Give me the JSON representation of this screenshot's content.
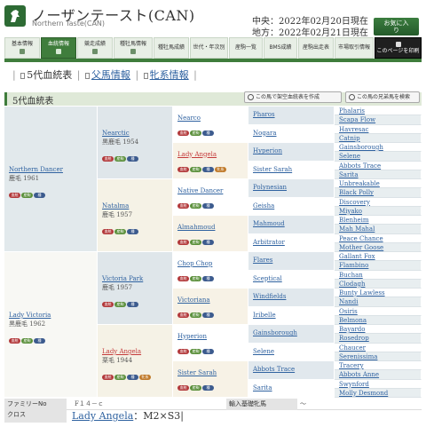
{
  "header": {
    "horse_name": "ノーザンテースト(CAN)",
    "horse_name_en": "Northern Taste(CAN)",
    "central_date": "中央：2022年02月20日現在",
    "local_date": "地方：2022年02月21日現在",
    "favorite_label_1": "お気に入",
    "favorite_label_2": "り",
    "logo_icon": "horse-icon"
  },
  "tabs": [
    {
      "label": "基本情報"
    },
    {
      "label": "血統情報"
    },
    {
      "label": "競走成績"
    },
    {
      "label": "種牡馬情報"
    },
    {
      "label": "種牡馬成績"
    },
    {
      "label": "世代・年次別"
    },
    {
      "label": "産駒一覧"
    },
    {
      "label": "BMS成績"
    },
    {
      "label": "産駒出走表"
    },
    {
      "label": "市場取引情報"
    },
    {
      "label": "このページを印刷"
    }
  ],
  "subnav": {
    "five_gen": "5代血統表",
    "sire_line": "父馬情報",
    "dam_line": "牝系情報"
  },
  "section": {
    "title": "5代血統表",
    "make_pedigree_btn": "この馬で架空血統表を作成",
    "siblings_btn": "この馬の兄弟馬を検索"
  },
  "badges": {
    "b1": "血統",
    "b2": "産駒",
    "b3": "種",
    "b4": "牝系"
  },
  "pedigree": {
    "g1": [
      {
        "name": "Northern Dancer",
        "meta": "鹿毛 1961",
        "red": false
      },
      {
        "name": "Lady Victoria",
        "meta": "黒鹿毛 1962",
        "red": false
      }
    ],
    "g2": [
      {
        "name": "Nearctic",
        "meta": "黒鹿毛 1954",
        "red": false
      },
      {
        "name": "Natalma",
        "meta": "鹿毛 1957",
        "red": false
      },
      {
        "name": "Victoria Park",
        "meta": "鹿毛 1957",
        "red": false
      },
      {
        "name": "Lady Angela",
        "meta": "栗毛 1944",
        "red": true
      }
    ],
    "g3": [
      {
        "name": "Nearco",
        "red": false
      },
      {
        "name": "Lady Angela",
        "red": true
      },
      {
        "name": "Native Dancer",
        "red": false
      },
      {
        "name": "Almahmoud",
        "red": false
      },
      {
        "name": "Chop Chop",
        "red": false
      },
      {
        "name": "Victoriana",
        "red": false
      },
      {
        "name": "Hyperion",
        "red": false
      },
      {
        "name": "Sister Sarah",
        "red": false
      }
    ],
    "g4": [
      "Pharos",
      "Nogara",
      "Hyperion",
      "Sister Sarah",
      "Polynesian",
      "Geisha",
      "Mahmoud",
      "Arbitrator",
      "Flares",
      "Sceptical",
      "Windfields",
      "Iribelle",
      "Gainsborough",
      "Selene",
      "Abbots Trace",
      "Sarita"
    ],
    "g5": [
      "Phalaris",
      "Scapa Flow",
      "Havresac",
      "Catnip",
      "Gainsborough",
      "Selene",
      "Abbots Trace",
      "Sarita",
      "Unbreakable",
      "Black Polly",
      "Discovery",
      "Miyako",
      "Blenheim",
      "Mah Mahal",
      "Peace Chance",
      "Mother Goose",
      "Gallant Fox",
      "Flambino",
      "Buchan",
      "Clodagh",
      "Bunty Lawless",
      "Nandi",
      "Osiris",
      "Belmona",
      "Bayardo",
      "Rosedrop",
      "Chaucer",
      "Serenissima",
      "Tracery",
      "Abbots Anne",
      "Swynford",
      "Molly Desmond"
    ]
  },
  "bottom": {
    "family_label": "ファミリーNo",
    "family_value": "F１４－ｃ",
    "import_label": "輸入基礎牝馬",
    "import_value": "～",
    "cross_label": "クロス",
    "cross_name": "Lady Angela",
    "cross_value": "：M2×S3"
  }
}
